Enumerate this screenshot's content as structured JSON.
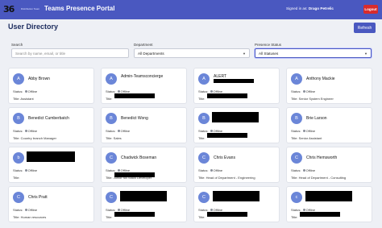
{
  "header": {
    "logo_text": "36",
    "logo_sub": "Distribution Team",
    "app_title": "Teams Presence Portal",
    "signed_in_label": "Signed in as:",
    "signed_in_user": "Drago Petrelic",
    "logout_label": "Logout",
    "bar_color": "#4a58c0"
  },
  "page": {
    "title": "User Directory",
    "refresh_label": "Refresh"
  },
  "filters": {
    "search_label": "Search",
    "search_placeholder": "Search by name, email, or title",
    "department_label": "Department",
    "department_value": "All Departments",
    "presence_label": "Presence Status",
    "presence_value": "All Statuses"
  },
  "labels": {
    "status": "Status:",
    "title": "Title:"
  },
  "cards": [
    {
      "initial": "A",
      "name": "Abby Brown",
      "status": "Offline",
      "title": "Assistant"
    },
    {
      "initial": "A",
      "name": "Admin-Teamsconcierge",
      "status": "Offline",
      "title": ""
    },
    {
      "initial": "A",
      "name": "ALERT",
      "status": "Offline",
      "title": ""
    },
    {
      "initial": "A",
      "name": "Anthony Mackie",
      "status": "Offline",
      "title": "Senior System Engineer"
    },
    {
      "initial": "B",
      "name": "Benedict Cumberbatch",
      "status": "Offline",
      "title": "Country branch Manager"
    },
    {
      "initial": "B",
      "name": "Benedict Wong",
      "status": "Offline",
      "title": "Sales"
    },
    {
      "initial": "B",
      "name": "",
      "status": "Offline",
      "title": ""
    },
    {
      "initial": "B",
      "name": "Brie Larson",
      "status": "Offline",
      "title": "Senior Assistant"
    },
    {
      "initial": "b",
      "name": "",
      "status": "Offline",
      "title": ""
    },
    {
      "initial": "C",
      "name": "Chadwick Boseman",
      "status": "Offline",
      "title": "Junior full Stack Developer"
    },
    {
      "initial": "C",
      "name": "Chris Evans",
      "status": "Offline",
      "title": "Head of Department - Engineering"
    },
    {
      "initial": "C",
      "name": "Chris Hemsworth",
      "status": "Offline",
      "title": "Head of Department - Consulting"
    },
    {
      "initial": "C",
      "name": "Chris Pratt",
      "status": "Offline",
      "title": "Human resources"
    },
    {
      "initial": "C",
      "name": "",
      "status": "Offline",
      "title": ""
    },
    {
      "initial": "C",
      "name": "",
      "status": "Offline",
      "title": ""
    },
    {
      "initial": "c",
      "name": "",
      "status": "Offline",
      "title": ""
    }
  ]
}
